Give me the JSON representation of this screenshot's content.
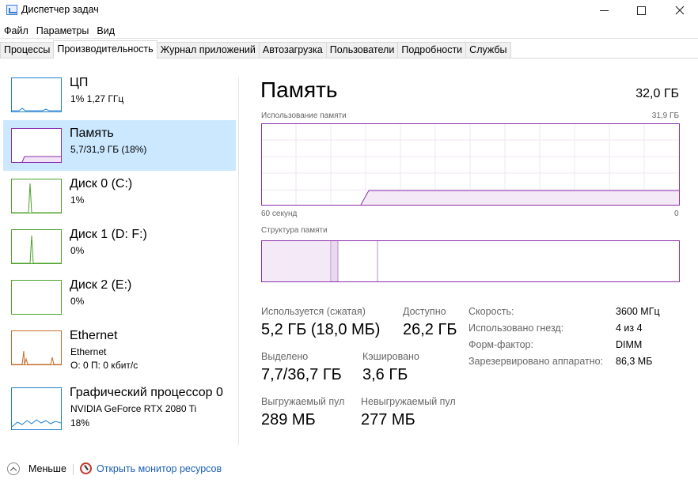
{
  "window": {
    "title": "Диспетчер задач",
    "icon": "task-manager-icon"
  },
  "menu": [
    "Файл",
    "Параметры",
    "Вид"
  ],
  "tabs": [
    {
      "label": "Процессы",
      "active": false
    },
    {
      "label": "Производительность",
      "active": true
    },
    {
      "label": "Журнал приложений",
      "active": false
    },
    {
      "label": "Автозагрузка",
      "active": false
    },
    {
      "label": "Пользователи",
      "active": false
    },
    {
      "label": "Подробности",
      "active": false
    },
    {
      "label": "Службы",
      "active": false
    }
  ],
  "sidebar": {
    "items": [
      {
        "name": "ЦП",
        "line1": "1% 1,27 ГГц",
        "line2": "",
        "color": "#1f7fd1",
        "active": false
      },
      {
        "name": "Память",
        "line1": "5,7/31,9 ГБ (18%)",
        "line2": "",
        "color": "#8b2fae",
        "active": true
      },
      {
        "name": "Диск 0 (C:)",
        "line1": "1%",
        "line2": "",
        "color": "#4ca22a",
        "active": false
      },
      {
        "name": "Диск 1 (D: F:)",
        "line1": "0%",
        "line2": "",
        "color": "#4ca22a",
        "active": false
      },
      {
        "name": "Диск 2 (E:)",
        "line1": "0%",
        "line2": "",
        "color": "#4ca22a",
        "active": false
      },
      {
        "name": "Ethernet",
        "line1": "Ethernet",
        "line2": "О: 0 П: 0 кбит/с",
        "color": "#c56a2a",
        "active": false
      },
      {
        "name": "Графический процессор 0",
        "line1": "NVIDIA GeForce RTX 2080 Ti",
        "line2": "18%",
        "color": "#1f7fd1",
        "active": false
      }
    ]
  },
  "main": {
    "title": "Память",
    "total": "32,0 ГБ",
    "usage_caption": "Использование памяти",
    "usage_max": "31,9 ГБ",
    "time_left": "60 секунд",
    "time_right": "0",
    "structure_caption": "Структура памяти",
    "accent": "#8b2fae",
    "stats": {
      "in_use_label": "Используется (сжатая)",
      "in_use_value": "5,2 ГБ (18,0 МБ)",
      "available_label": "Доступно",
      "available_value": "26,2 ГБ",
      "committed_label": "Выделено",
      "committed_value": "7,7/36,7 ГБ",
      "cached_label": "Кэшировано",
      "cached_value": "3,6 ГБ",
      "paged_label": "Выгружаемый пул",
      "paged_value": "289 МБ",
      "nonpaged_label": "Невыгружаемый пул",
      "nonpaged_value": "277 МБ"
    },
    "props": [
      {
        "label": "Скорость:",
        "value": "3600 МГц"
      },
      {
        "label": "Использовано гнезд:",
        "value": "4 из 4"
      },
      {
        "label": "Форм-фактор:",
        "value": "DIMM"
      },
      {
        "label": "Зарезервировано аппаратно:",
        "value": "86,3 МБ"
      }
    ]
  },
  "footer": {
    "less_label": "Меньше",
    "resmon_label": "Открыть монитор ресурсов"
  }
}
